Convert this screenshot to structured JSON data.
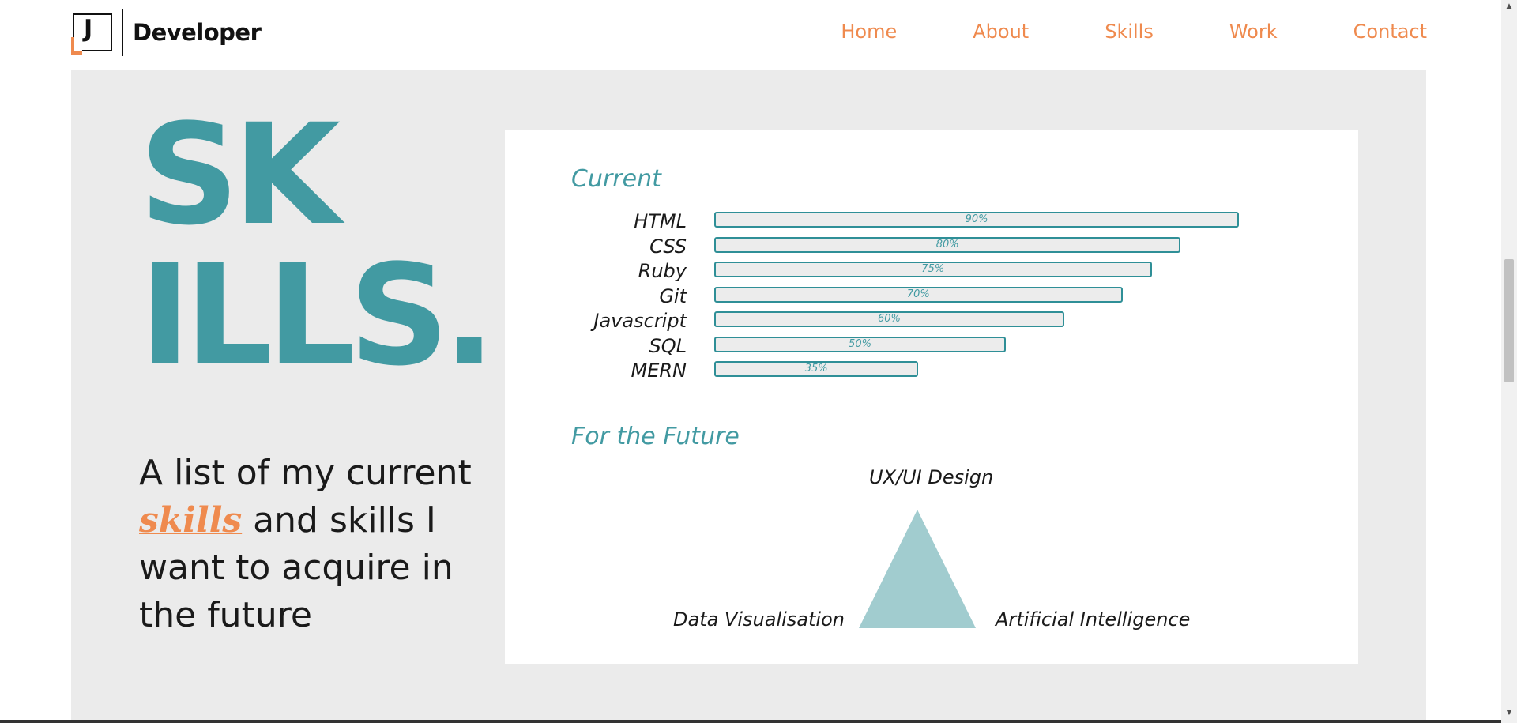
{
  "header": {
    "logo_letter": "J",
    "brand": "Developer",
    "nav": [
      "Home",
      "About",
      "Skills",
      "Work",
      "Contact"
    ]
  },
  "hero": {
    "title_line1": "SK",
    "title_line2": "ILLS.",
    "intro_before": "A list of my current ",
    "intro_accent": "skills",
    "intro_after": " and skills I want to acquire in the future"
  },
  "current": {
    "heading": "Current",
    "skills": [
      {
        "name": "HTML",
        "label": "90%",
        "value": 90
      },
      {
        "name": "CSS",
        "label": "80%",
        "value": 80
      },
      {
        "name": "Ruby",
        "label": "75%",
        "value": 75
      },
      {
        "name": "Git",
        "label": "70%",
        "value": 70
      },
      {
        "name": "Javascript",
        "label": "60%",
        "value": 60
      },
      {
        "name": "SQL",
        "label": "50%",
        "value": 50
      },
      {
        "name": "MERN",
        "label": "35%",
        "value": 35
      }
    ]
  },
  "future": {
    "heading": "For the Future",
    "top": "UX/UI Design",
    "left": "Data Visualisation",
    "right": "Artificial Intelligence"
  },
  "colors": {
    "accent_orange": "#ef8a4e",
    "accent_teal": "#429aa2",
    "triangle_teal": "#a1cccf",
    "panel_bg": "#ebebeb"
  },
  "icons": {
    "scroll_up": "triangle-up-icon",
    "scroll_down": "triangle-down-icon"
  }
}
